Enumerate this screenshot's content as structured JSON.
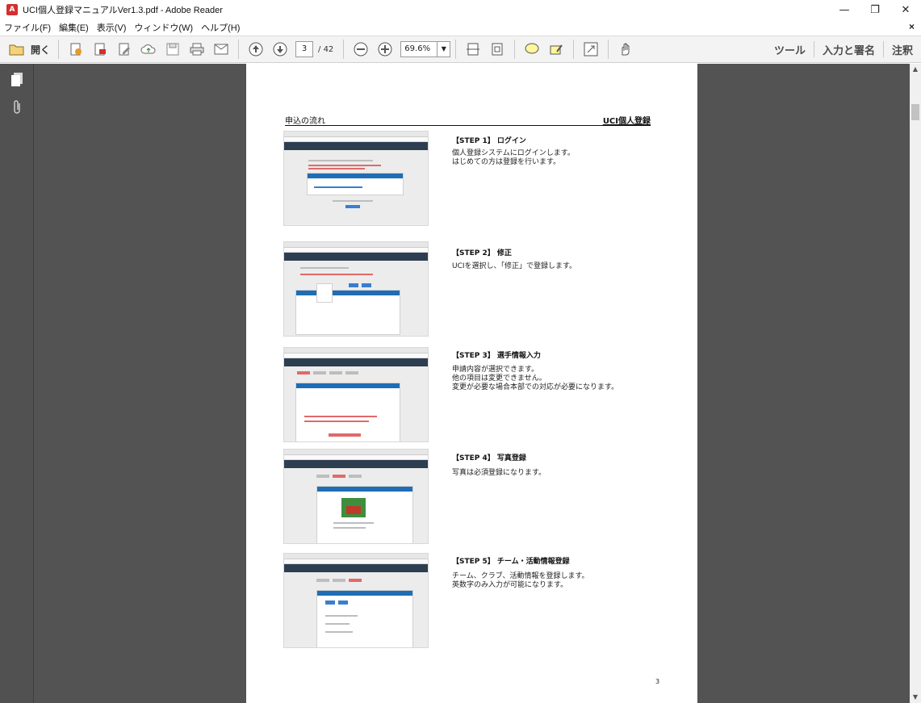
{
  "window": {
    "title": "UCI個人登録マニュアルVer1.3.pdf - Adobe Reader",
    "app_icon_label": "A",
    "minimize": "—",
    "restore": "❐",
    "close": "✕"
  },
  "menu": {
    "items": [
      "ファイル(F)",
      "編集(E)",
      "表示(V)",
      "ウィンドウ(W)",
      "ヘルプ(H)"
    ],
    "close_doc": "×"
  },
  "toolbar": {
    "open_label": "開く",
    "current_page": "3",
    "total_pages": "/ 42",
    "zoom": "69.6%",
    "zoom_dropdown": "▼",
    "right_items": [
      "ツール",
      "入力と署名",
      "注釈"
    ]
  },
  "scrollbar": {
    "up": "▲",
    "down": "▼"
  },
  "page": {
    "header_left": "申込の流れ",
    "header_right": "UCI個人登録",
    "number": "3",
    "steps": [
      {
        "title": "【STEP 1】 ログイン",
        "desc": "個人登録システムにログインします。\nはじめての方は登録を行います。"
      },
      {
        "title": "【STEP 2】 修正",
        "desc": "UCIを選択し、「修正」で登録します。"
      },
      {
        "title": "【STEP 3】 選手情報入力",
        "desc": "申請内容が選択できます。\n他の項目は変更できません。\n変更が必要な場合本部での対応が必要になります。"
      },
      {
        "title": "【STEP 4】 写真登録",
        "desc": "写真は必須登録になります。"
      },
      {
        "title": "【STEP 5】 チーム・活動情報登録",
        "desc": "チーム、クラブ、活動情報を登録します。\n英数字のみ入力が可能になります。"
      }
    ]
  },
  "colors": {
    "nav_dark": "#535353",
    "accent_blue": "#1f6db5",
    "app_red": "#d32f2f"
  }
}
